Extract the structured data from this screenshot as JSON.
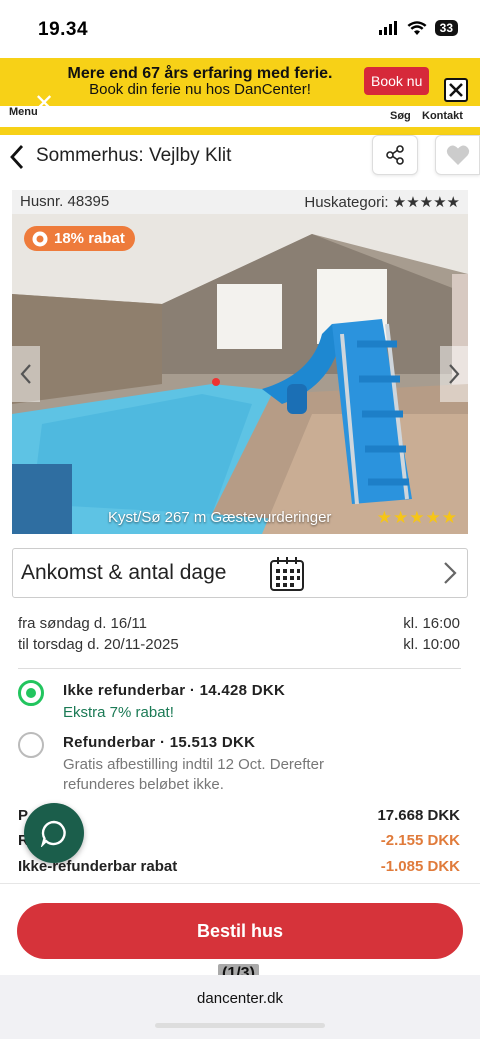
{
  "status_bar": {
    "time": "19.34",
    "battery": "33"
  },
  "banner": {
    "line1": "Mere end 67 års erfaring med ferie.",
    "line2": "Book din ferie nu hos DanCenter!",
    "button": "Book nu"
  },
  "nav": {
    "menu": "Menu",
    "search": "Søg",
    "contact": "Kontakt"
  },
  "header": {
    "title": "Sommerhus: Vejlby Klit"
  },
  "info": {
    "house_no": "Husnr. 48395",
    "category": "Huskategori: ★★★★★"
  },
  "photo": {
    "badge": "18% rabat",
    "caption": "Kyst/Sø 267 m  Gæstevurderinger",
    "rating_stars": "★★★★★"
  },
  "arrival": {
    "label": "Ankomst & antal dage"
  },
  "dates": {
    "from_label": "fra  søndag  d. 16/11",
    "from_time": "kl. 16:00",
    "to_label": "til  torsdag d. 20/11-2025",
    "to_time": "kl. 10:00"
  },
  "options": [
    {
      "title": "Ikke refunderbar · 14.428 DKK",
      "sub": "Ekstra 7% rabat!",
      "selected": true
    },
    {
      "title": "Refunderbar · 15.513 DKK",
      "sub": "Gratis afbestilling indtil 12 Oct. Derefter refunderes beløbet ikke.",
      "selected": false
    }
  ],
  "prices": {
    "row1_label": "P",
    "row1_amount": "17.668 DKK",
    "row2_label": "R",
    "row2_amount": "-2.155 DKK",
    "row3_label": "Ikke-refunderbar rabat",
    "row3_amount": "-1.085 DKK"
  },
  "cta": {
    "book": "Bestil hus"
  },
  "pager": {
    "counter": "(1/3)"
  },
  "browser": {
    "domain": "dancenter.dk"
  },
  "colors": {
    "brand_yellow": "#f7d117",
    "accent_red": "#d6333a",
    "discount_orange": "#ee7b3b",
    "success_green": "#22c55e",
    "chat_green": "#1b5e4b"
  }
}
